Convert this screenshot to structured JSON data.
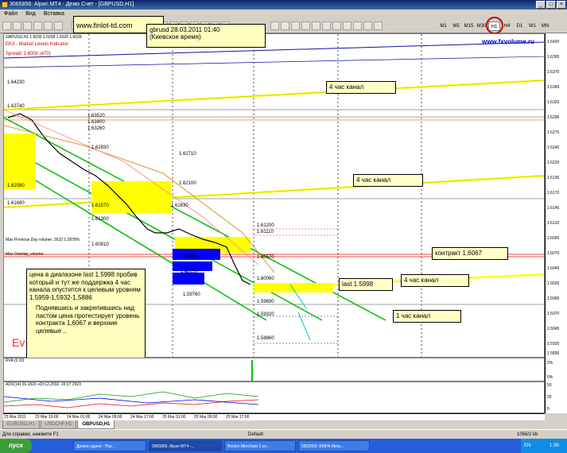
{
  "window": {
    "title": "3065856: Alpari MT4 - Демо Счет - [GBPUSD,H1]"
  },
  "menu": [
    "Файл",
    "Вид",
    "Вставка"
  ],
  "toolbar": {
    "timeframes": [
      "M1",
      "M5",
      "M15",
      "M30",
      "H1",
      "H4",
      "D1",
      "W1",
      "MN"
    ],
    "active_timeframe": "H1"
  },
  "watermark_site": "www.finlot-td.com",
  "fxvolume_site": "www.fxvolume.ru",
  "chart": {
    "symbol_line": "GBPUSD,H1 1.6035 1.6038 1.6020 1.6028",
    "indicator_label_1": "EK3 - Market Levels Indicator",
    "indicator_label_2": "Spread: 1.6000 (470)",
    "price_levels": [
      "1.64230",
      "1.63740",
      "1.63520",
      "1.63400",
      "1.63260",
      "1.62830",
      "1.62710",
      "1.62100",
      "1.62080",
      "1.61680",
      "1.61630",
      "1.61570",
      "1.61300",
      "1.61200",
      "1.61110",
      "1.60810",
      "1.60600",
      "1.60570",
      "1.60250",
      "1.60060",
      "1.59760",
      "1.59690",
      "1.59320",
      "1.58860"
    ],
    "left_labels": [
      "Max Previous Day volume: 2632 1.2878%",
      "Max Overlap_volume"
    ],
    "overlay_text": "Ev"
  },
  "annotations": {
    "date_box": {
      "line1": "gbrusd 28.03.2011 01:40",
      "line2": "(Киевское время)"
    },
    "channel_4h_1": "4 час канал",
    "channel_4h_2": "4 час канал",
    "channel_4h_3": "4 час канал",
    "contract": "контракт 1,6067",
    "last_price": "last 1.5998",
    "channel_1h": "1 час канал",
    "main_comment": {
      "p1": "цена в диапазоне  last 1.5998 пробив который и тут же поддержка 4 час канала опустится к целевым уровням 1.5959-1,5932-1,5886",
      "p2": "Поднявшись и закрепившись над ластом цена  протестирует уровень контракта 1,6067 и верхние целевые .."
    }
  },
  "price_axis": [
    "1.6420",
    "1.6395",
    "1.6370",
    "1.6345",
    "1.6320",
    "1.6295",
    "1.6270",
    "1.6245",
    "1.6220",
    "1.6195",
    "1.6170",
    "1.6145",
    "1.6120",
    "1.6095",
    "1.6070",
    "1.6045",
    "1.6020",
    "1.5995",
    "1.5970",
    "1.5945",
    "1.5920",
    "1.5895"
  ],
  "indicators": {
    "rva_label": "RVA (0 DI)",
    "rva_axis": [
      "2%",
      "0%"
    ],
    "adx_label": "ADX(14) 26.1820 +DI:12.2592 -DI:27.2923",
    "adx_axis": [
      "50",
      "25",
      "0"
    ]
  },
  "time_axis": [
    "23 Mar 2011",
    "23 Mar 19:00",
    "24 Mar 01:00",
    "24 Mar 09:00",
    "24 Mar 17:00",
    "25 Mar 01:00",
    "25 Mar 09:00",
    "25 Mar 17:00"
  ],
  "tabs": [
    "EURUSD,H1",
    "USDCHF,H1",
    "GBPUSD,H1"
  ],
  "active_tab": "GBPUSD,H1",
  "status": {
    "help": "Для справки, нажмите F1",
    "profile": "Default",
    "traffic": "1056/2 kb"
  },
  "taskbar": {
    "start": "пуск",
    "tasks": [
      "Дракон удачи : Поз...",
      "3065856: Alpari MT4 -...",
      "Boston Merchant-1 co...",
      "5602559: BMFN Meta..."
    ],
    "lang": "EN",
    "clock": "1:39"
  },
  "colors": {
    "channel_yellow": "#ffff00",
    "channel_green": "#00c000",
    "volume_blue": "#0000ff",
    "contract_red": "#ff4040"
  }
}
